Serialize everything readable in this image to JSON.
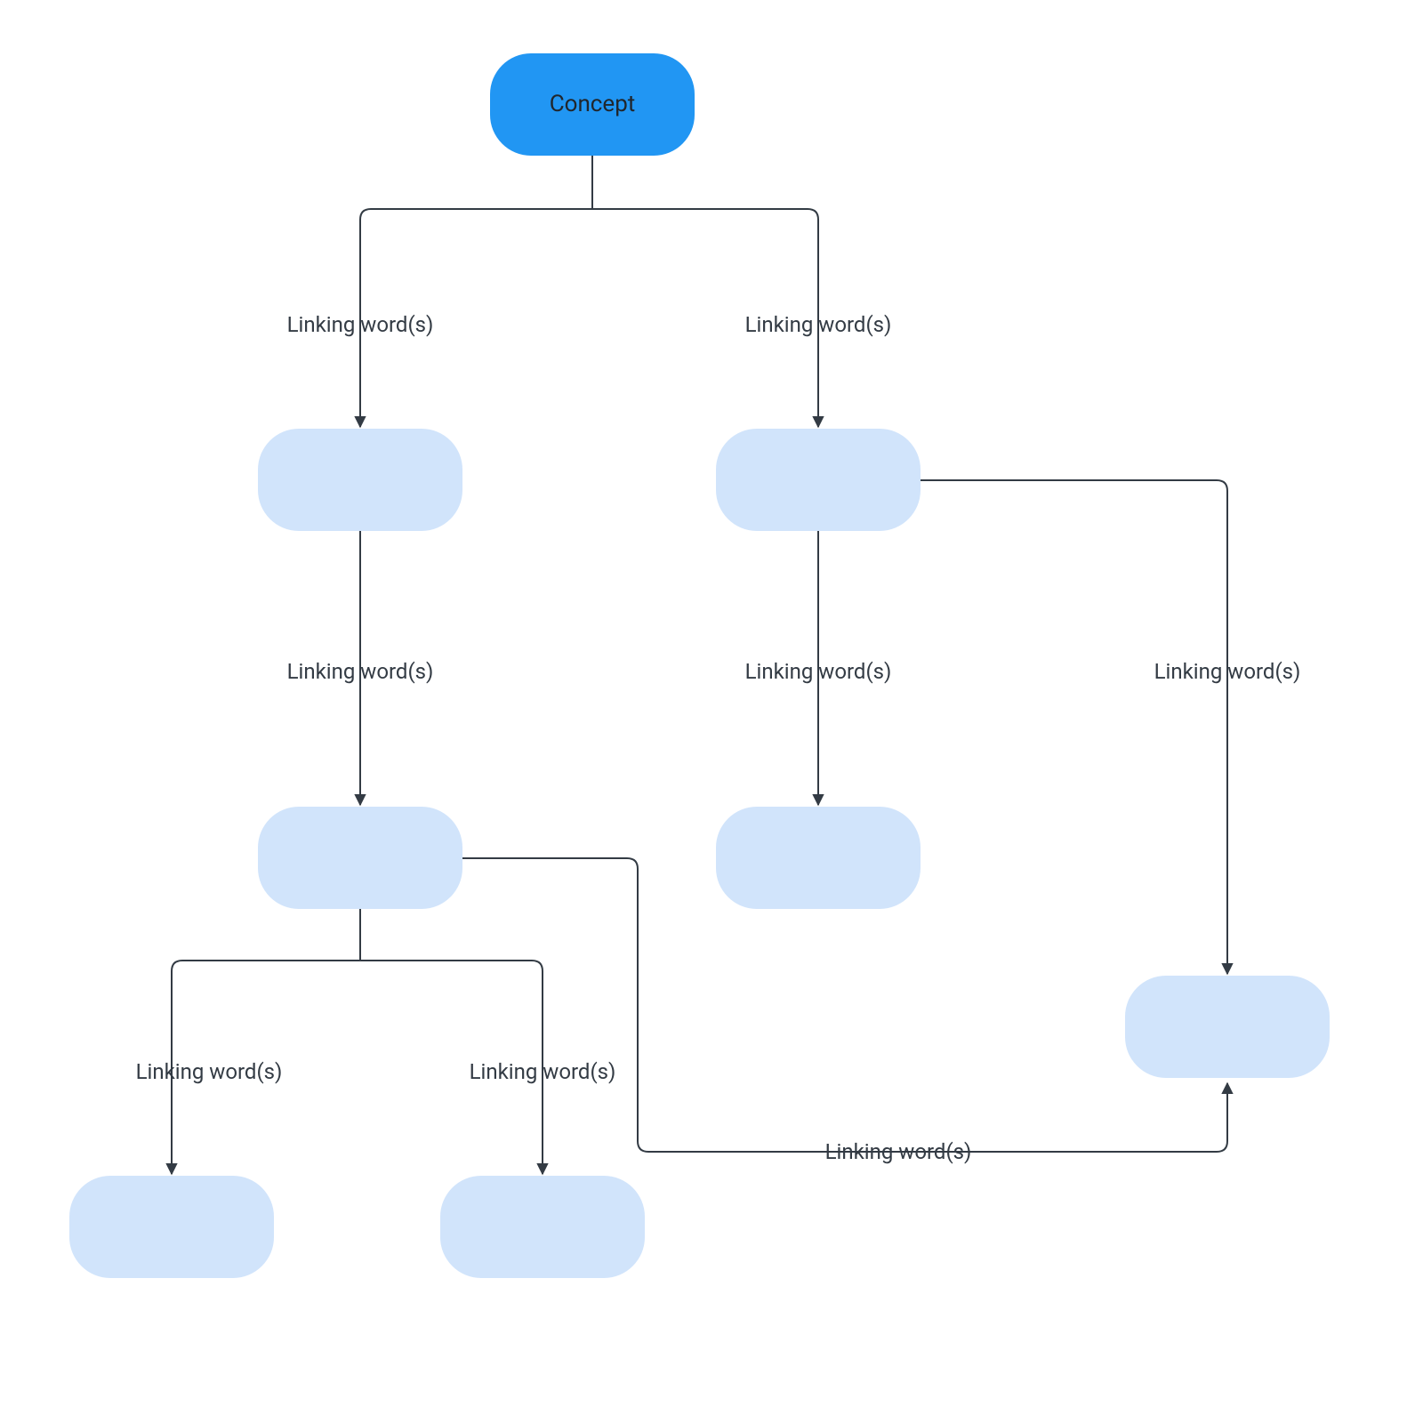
{
  "colors": {
    "root_fill": "#2196f3",
    "child_fill": "#d1e4fb",
    "stroke": "#333b44",
    "root_text": "#20262c"
  },
  "nodes": {
    "root": {
      "label": "Concept"
    },
    "n_left1": {
      "label": ""
    },
    "n_right1": {
      "label": ""
    },
    "n_left2": {
      "label": ""
    },
    "n_right2": {
      "label": ""
    },
    "n_botL": {
      "label": ""
    },
    "n_botM": {
      "label": ""
    },
    "n_far": {
      "label": ""
    }
  },
  "edges": {
    "e_root_left": {
      "label": "Linking word(s)"
    },
    "e_root_right": {
      "label": "Linking word(s)"
    },
    "e_left1_left2": {
      "label": "Linking word(s)"
    },
    "e_right1_right2": {
      "label": "Linking word(s)"
    },
    "e_right1_far": {
      "label": "Linking word(s)"
    },
    "e_left2_botL": {
      "label": "Linking word(s)"
    },
    "e_left2_botM": {
      "label": "Linking word(s)"
    },
    "e_left2_far": {
      "label": "Linking word(s)"
    }
  }
}
